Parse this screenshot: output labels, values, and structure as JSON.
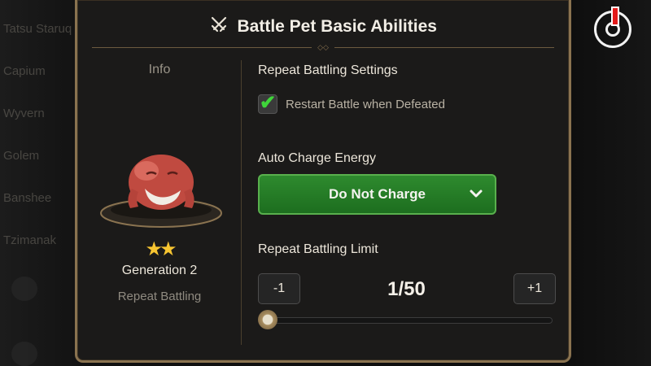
{
  "background": {
    "side_items": [
      "Tatsu Staruq",
      "Capium",
      "Wyvern",
      "Golem",
      "Banshee",
      "Tzimanak"
    ]
  },
  "power_button": {
    "icon": "power-icon"
  },
  "dialog": {
    "title_icon": "crossed-swords-icon",
    "title": "Battle Pet Basic Abilities",
    "left": {
      "info_label": "Info",
      "pet_image": "red-pet-creature",
      "star_count": 2,
      "stars_text": "★★",
      "generation": "Generation 2",
      "mode": "Repeat Battling"
    },
    "right": {
      "repeat_settings_label": "Repeat Battling Settings",
      "restart_checkbox": {
        "label": "Restart Battle when Defeated",
        "checked": true
      },
      "auto_charge_label": "Auto Charge Energy",
      "auto_charge_value": "Do Not Charge",
      "limit_label": "Repeat Battling Limit",
      "minus_label": "-1",
      "plus_label": "+1",
      "limit_value": "1/50",
      "slider": {
        "current": 1,
        "max": 50
      }
    }
  },
  "colors": {
    "accent_gold": "#8a7350",
    "check_green": "#3fd63a",
    "dropdown_green": "#2e8a2e",
    "star_yellow": "#f7c531",
    "power_red": "#e31b1b"
  }
}
